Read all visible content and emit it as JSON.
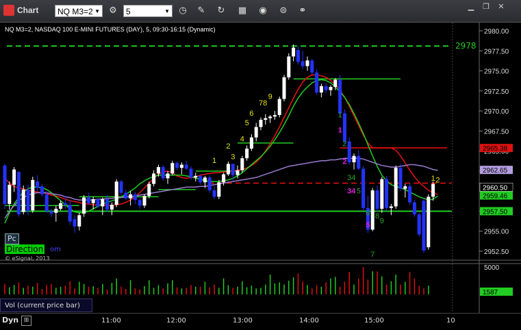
{
  "window": {
    "title": "Chart",
    "symbol": "NQ M3=2",
    "interval": "5",
    "buttons": [
      "interval-icon",
      "pencil-icon",
      "refresh-icon",
      "studies-icon",
      "play-icon",
      "properties-icon",
      "link-icon"
    ],
    "window_controls": [
      "minimize",
      "restore",
      "close"
    ]
  },
  "chart": {
    "series_title": "NQ M3=2, NASDAQ 100 E-MINI FUTURES (DAY), 5, 09:30-16:15 (Dynamic)",
    "pc_label": "Pc",
    "direction_label": "Direction",
    "copyright": "© eSignal, 2013",
    "volume_label": "Vol (current price bar)",
    "dyn_label": "Dyn",
    "top_line_label": "2978",
    "colors": {
      "up": "#ffffff",
      "down": "#2233ff",
      "green": "#22cc22",
      "red": "#ee1111",
      "purple": "#9b7bd0",
      "count_yellow": "#e5e51a",
      "count_green": "#29a829",
      "count_magenta": "#e020e0"
    }
  },
  "chart_data": {
    "type": "candlestick",
    "title": "NQ M3=2, NASDAQ 100 E-MINI FUTURES (DAY), 5, 09:30-16:15 (Dynamic)",
    "y_axis": {
      "ticks": [
        "2980.00",
        "2977.50",
        "2975.00",
        "2972.50",
        "2970.00",
        "2967.50",
        "2965.00",
        "2962.50",
        "2960.00",
        "2957.50",
        "2955.00",
        "2952.50"
      ],
      "range": [
        2951,
        2981.5
      ]
    },
    "x_axis": {
      "ticks": [
        "11:00",
        "12:00",
        "13:00",
        "14:00",
        "15:00",
        "10"
      ]
    },
    "price_labels": [
      {
        "text": "2965.38",
        "value": 2965.38,
        "bg": "#dd1111",
        "fg": "#000000"
      },
      {
        "text": "2962.65",
        "value": 2962.65,
        "bg": "#b49ee0",
        "fg": "#000000"
      },
      {
        "text": "2960.50",
        "value": 2960.5,
        "bg": "#000000",
        "fg": "#ffffff"
      },
      {
        "text": "2959.46",
        "value": 2959.46,
        "bg": "#22cc22",
        "fg": "#000000"
      },
      {
        "text": "2957.50",
        "value": 2957.5,
        "bg": "#22cc22",
        "fg": "#000000"
      }
    ],
    "volume_axis": {
      "ticks": [
        "5000",
        "1587"
      ]
    },
    "levels": [
      {
        "name": "top-dashed",
        "value": 2978.1,
        "color": "#22cc22",
        "style": "dashed"
      },
      {
        "name": "support",
        "value": 2957.5,
        "color": "#22cc22",
        "style": "solid"
      },
      {
        "name": "red-dashed",
        "value": 2961.0,
        "color": "#ee1111",
        "style": "dashed"
      }
    ],
    "candles": [
      [
        2963.2,
        2963.4,
        2957.8,
        2958.4
      ],
      [
        2958.4,
        2961.2,
        2957.7,
        2960.8
      ],
      [
        2960.8,
        2963.0,
        2959.9,
        2962.7
      ],
      [
        2962.4,
        2962.5,
        2956.8,
        2957.1
      ],
      [
        2957.4,
        2960.7,
        2957.1,
        2960.2
      ],
      [
        2960.2,
        2960.8,
        2957.0,
        2957.5
      ],
      [
        2957.6,
        2961.8,
        2957.3,
        2961.4
      ],
      [
        2961.2,
        2962.0,
        2960.0,
        2960.4
      ],
      [
        2960.6,
        2960.9,
        2959.3,
        2959.6
      ],
      [
        2959.6,
        2960.0,
        2957.3,
        2957.5
      ],
      [
        2957.5,
        2957.8,
        2956.8,
        2957.2
      ],
      [
        2957.3,
        2958.2,
        2956.2,
        2957.8
      ],
      [
        2957.8,
        2958.8,
        2957.6,
        2958.5
      ],
      [
        2958.5,
        2959.4,
        2957.8,
        2958.3
      ],
      [
        2958.3,
        2958.9,
        2955.8,
        2956.2
      ],
      [
        2956.5,
        2957.0,
        2954.8,
        2955.6
      ],
      [
        2955.6,
        2957.3,
        2955.1,
        2957.0
      ],
      [
        2957.2,
        2959.5,
        2956.8,
        2959.2
      ],
      [
        2959.2,
        2959.8,
        2958.3,
        2958.5
      ],
      [
        2958.5,
        2959.3,
        2957.7,
        2959.0
      ],
      [
        2959.0,
        2959.1,
        2957.9,
        2958.1
      ],
      [
        2958.1,
        2959.2,
        2957.0,
        2959.0
      ],
      [
        2959.0,
        2959.5,
        2957.4,
        2957.7
      ],
      [
        2957.7,
        2958.6,
        2957.0,
        2958.3
      ],
      [
        2958.3,
        2961.5,
        2958.0,
        2961.2
      ],
      [
        2961.2,
        2961.4,
        2959.5,
        2959.8
      ],
      [
        2959.8,
        2960.2,
        2958.9,
        2959.1
      ],
      [
        2959.1,
        2960.0,
        2958.2,
        2959.6
      ],
      [
        2959.6,
        2959.9,
        2958.4,
        2958.9
      ],
      [
        2958.9,
        2959.1,
        2957.8,
        2958.2
      ],
      [
        2958.2,
        2959.6,
        2957.9,
        2959.4
      ],
      [
        2959.4,
        2961.2,
        2959.1,
        2960.9
      ],
      [
        2960.9,
        2962.6,
        2960.6,
        2962.2
      ],
      [
        2962.2,
        2963.3,
        2961.8,
        2963.0
      ],
      [
        2963.0,
        2963.3,
        2961.3,
        2961.6
      ],
      [
        2961.6,
        2962.5,
        2960.9,
        2962.2
      ],
      [
        2962.2,
        2963.8,
        2962.0,
        2963.5
      ],
      [
        2963.5,
        2963.7,
        2962.6,
        2962.9
      ],
      [
        2962.9,
        2963.6,
        2962.1,
        2963.3
      ],
      [
        2963.3,
        2963.8,
        2962.6,
        2962.8
      ],
      [
        2962.8,
        2963.1,
        2961.4,
        2961.7
      ],
      [
        2961.7,
        2962.3,
        2961.2,
        2961.9
      ],
      [
        2961.9,
        2962.1,
        2960.8,
        2961.1
      ],
      [
        2961.1,
        2961.9,
        2960.4,
        2961.7
      ],
      [
        2961.7,
        2962.0,
        2959.8,
        2960.1
      ],
      [
        2960.1,
        2960.6,
        2959.0,
        2959.3
      ],
      [
        2959.3,
        2961.4,
        2959.0,
        2961.1
      ],
      [
        2961.1,
        2962.3,
        2960.7,
        2962.1
      ],
      [
        2962.1,
        2963.7,
        2961.9,
        2963.4
      ],
      [
        2963.4,
        2962.4,
        2961.2,
        2962.0
      ],
      [
        2962.0,
        2963.2,
        2961.6,
        2962.6
      ],
      [
        2962.6,
        2964.4,
        2962.3,
        2964.1
      ],
      [
        2964.1,
        2965.7,
        2963.8,
        2965.3
      ],
      [
        2965.3,
        2967.1,
        2965.0,
        2966.7
      ],
      [
        2966.7,
        2968.5,
        2966.2,
        2968.0
      ],
      [
        2968.0,
        2969.2,
        2967.6,
        2968.9
      ],
      [
        2968.9,
        2969.6,
        2968.3,
        2969.1
      ],
      [
        2969.1,
        2969.5,
        2968.5,
        2969.3
      ],
      [
        2969.3,
        2970.0,
        2968.9,
        2969.5
      ],
      [
        2969.5,
        2971.8,
        2969.2,
        2971.5
      ],
      [
        2971.5,
        2974.5,
        2971.2,
        2974.2
      ],
      [
        2974.2,
        2977.2,
        2973.9,
        2976.8
      ],
      [
        2976.8,
        2978.3,
        2976.2,
        2977.9
      ],
      [
        2977.6,
        2978.1,
        2975.8,
        2976.1
      ],
      [
        2976.2,
        2977.5,
        2975.2,
        2975.6
      ],
      [
        2975.6,
        2976.8,
        2975.0,
        2976.3
      ],
      [
        2976.3,
        2976.5,
        2974.5,
        2974.8
      ],
      [
        2974.8,
        2975.2,
        2972.0,
        2972.3
      ],
      [
        2972.3,
        2973.4,
        2971.7,
        2973.1
      ],
      [
        2973.1,
        2973.5,
        2972.2,
        2972.6
      ],
      [
        2972.6,
        2973.2,
        2971.9,
        2973.0
      ],
      [
        2973.0,
        2974.1,
        2972.6,
        2973.9
      ],
      [
        2973.9,
        2974.5,
        2969.3,
        2969.7
      ],
      [
        2969.7,
        2970.2,
        2965.9,
        2966.2
      ],
      [
        2966.2,
        2966.7,
        2963.3,
        2963.6
      ],
      [
        2963.6,
        2964.7,
        2962.7,
        2964.4
      ],
      [
        2964.4,
        2965.1,
        2962.6,
        2962.8
      ],
      [
        2962.8,
        2963.1,
        2957.6,
        2957.9
      ],
      [
        2957.9,
        2959.4,
        2954.8,
        2955.2
      ],
      [
        2955.2,
        2960.4,
        2955.0,
        2960.1
      ],
      [
        2960.1,
        2960.7,
        2957.4,
        2957.8
      ],
      [
        2957.8,
        2961.8,
        2957.3,
        2961.5
      ],
      [
        2961.5,
        2961.9,
        2957.5,
        2957.9
      ],
      [
        2957.9,
        2958.4,
        2957.0,
        2958.1
      ],
      [
        2958.1,
        2963.2,
        2957.8,
        2962.9
      ],
      [
        2962.9,
        2963.4,
        2960.0,
        2960.3
      ],
      [
        2960.3,
        2960.9,
        2959.2,
        2960.6
      ],
      [
        2960.6,
        2961.0,
        2958.3,
        2958.6
      ],
      [
        2958.6,
        2958.9,
        2956.8,
        2957.1
      ],
      [
        2957.1,
        2957.3,
        2954.3,
        2954.6
      ],
      [
        2958.8,
        2959.1,
        2952.3,
        2952.6
      ],
      [
        2953.0,
        2959.6,
        2952.7,
        2959.3
      ],
      [
        2959.3,
        2961.2,
        2958.8,
        2960.9
      ]
    ],
    "lines": {
      "red": [
        2961.6,
        2961.0,
        2960.6,
        2960.4,
        2960.3,
        2960.1,
        2960.0,
        2959.9,
        2959.8,
        2959.7,
        2959.5,
        2959.4,
        2959.2,
        2959.0,
        2958.8,
        2958.7,
        2958.6,
        2958.4,
        2958.4,
        2958.3,
        2958.3,
        2958.3,
        2958.2,
        2958.2,
        2958.3,
        2958.4,
        2958.6,
        2958.9,
        2959.3,
        2959.8,
        2960.4,
        2961.0,
        2961.6,
        2962.1,
        2962.4,
        2962.5,
        2962.3,
        2961.9,
        2961.7,
        2961.6,
        2961.7,
        2961.8,
        2962.0,
        2962.1,
        2962.2,
        2962.3,
        2962.3,
        2962.4,
        2962.4,
        2962.5,
        2962.6,
        2962.7,
        2962.9,
        2963.2,
        2963.6,
        2964.2,
        2965.0,
        2965.9,
        2966.9,
        2968.0,
        2969.2,
        2970.4,
        2971.6,
        2972.7,
        2973.6,
        2974.2,
        2974.5,
        2974.5,
        2974.4,
        2974.2,
        2973.8,
        2973.3,
        2972.6,
        2971.7,
        2970.6,
        2969.4,
        2968.2,
        2967.0,
        2966.0,
        2965.4,
        2965.4,
        2965.4,
        2965.4,
        2965.4,
        2965.1,
        2964.4,
        2963.5,
        2962.6,
        2961.8,
        2961.1,
        2960.6,
        2960.1,
        2959.8,
        2959.6
      ],
      "green": [
        2956.0,
        2957.3,
        2958.4,
        2959.2,
        2959.9,
        2960.3,
        2960.5,
        2960.5,
        2960.4,
        2960.2,
        2959.8,
        2959.3,
        2958.8,
        2958.3,
        2957.8,
        2957.4,
        2957.3,
        2957.3,
        2957.5,
        2957.8,
        2958.1,
        2958.4,
        2958.6,
        2958.8,
        2959.0,
        2959.3,
        2959.6,
        2960.0,
        2960.4,
        2960.9,
        2961.3,
        2961.6,
        2961.8,
        2962.0,
        2962.0,
        2962.0,
        2962.0,
        2962.0,
        2962.0,
        2961.9,
        2961.8,
        2961.6,
        2961.5,
        2961.3,
        2961.2,
        2961.2,
        2961.2,
        2961.3,
        2961.4,
        2961.6,
        2961.9,
        2962.3,
        2962.8,
        2963.3,
        2963.8,
        2964.3,
        2964.9,
        2965.6,
        2966.4,
        2967.3,
        2968.3,
        2969.4,
        2970.6,
        2971.6,
        2972.4,
        2973.0,
        2973.5,
        2973.8,
        2973.9,
        2973.8,
        2973.5,
        2973.0,
        2972.4,
        2971.7,
        2970.8,
        2969.7,
        2968.5,
        2967.2,
        2965.8,
        2964.4,
        2963.1,
        2962.0,
        2961.3,
        2960.8,
        2960.6,
        2960.4,
        2960.2,
        2959.9,
        2959.6,
        2959.3,
        2959.1,
        2958.9,
        2959.0,
        2959.4
      ],
      "purple": [
        2956.6,
        2957.5,
        2958.2,
        2958.8,
        2959.2,
        2959.5,
        2959.7,
        2959.8,
        2959.8,
        2959.8,
        2959.7,
        2959.6,
        2959.5,
        2959.3,
        2959.2,
        2959.0,
        2958.9,
        2958.9,
        2958.9,
        2958.9,
        2959.0,
        2959.0,
        2959.1,
        2959.1,
        2959.2,
        2959.2,
        2959.3,
        2959.3,
        2959.4,
        2959.5,
        2959.6,
        2959.7,
        2959.8,
        2959.9,
        2960.0,
        2960.1,
        2960.2,
        2960.3,
        2960.4,
        2960.5,
        2960.5,
        2960.5,
        2960.6,
        2960.6,
        2960.7,
        2960.8,
        2960.9,
        2961.0,
        2961.1,
        2961.2,
        2961.3,
        2961.4,
        2961.5,
        2961.6,
        2961.7,
        2961.9,
        2962.1,
        2962.3,
        2962.5,
        2962.7,
        2962.9,
        2963.1,
        2963.2,
        2963.3,
        2963.4,
        2963.5,
        2963.6,
        2963.7,
        2963.8,
        2963.8,
        2963.9,
        2963.9,
        2964.0,
        2964.1,
        2964.1,
        2964.1,
        2964.1,
        2964.0,
        2963.8,
        2963.6,
        2963.4,
        2963.2,
        2963.1,
        2963.0,
        2963.0,
        2963.1,
        2963.2,
        2963.3,
        2963.3,
        2963.2,
        2963.1,
        2962.9,
        2962.7,
        2962.6
      ]
    },
    "steps": {
      "green": [
        {
          "from": 0,
          "to": 16,
          "value": 2958.2
        },
        {
          "from": 16,
          "to": 33,
          "value": 2959.3
        },
        {
          "from": 33,
          "to": 41,
          "value": 2960.2
        },
        {
          "from": 41,
          "to": 50,
          "value": 2962.5
        },
        {
          "from": 50,
          "to": 62,
          "value": 2966.0
        },
        {
          "from": 62,
          "to": 85,
          "value": 2974.0
        }
      ],
      "red": [
        {
          "from": 72,
          "to": 95,
          "value": 2965.4
        }
      ]
    },
    "counts": [
      {
        "text": "1",
        "bar": 45,
        "value": 2963.5,
        "color": "yellow"
      },
      {
        "text": "2",
        "bar": 48,
        "value": 2965.3,
        "color": "yellow"
      },
      {
        "text": "3",
        "bar": 49,
        "value": 2964.0,
        "color": "yellow"
      },
      {
        "text": "4",
        "bar": 51,
        "value": 2966.2,
        "color": "yellow"
      },
      {
        "text": "5",
        "bar": 52,
        "value": 2968.2,
        "color": "yellow"
      },
      {
        "text": "6",
        "bar": 53,
        "value": 2969.4,
        "color": "yellow"
      },
      {
        "text": "78",
        "bar": 55,
        "value": 2970.7,
        "color": "yellow"
      },
      {
        "text": "9",
        "bar": 57,
        "value": 2971.5,
        "color": "yellow"
      },
      {
        "text": "1",
        "bar": 72,
        "value": 2969.2,
        "color": "green"
      },
      {
        "text": "1",
        "bar": 72,
        "value": 2967.3,
        "color": "magenta"
      },
      {
        "text": "2",
        "bar": 73,
        "value": 2965.6,
        "color": "green"
      },
      {
        "text": "2",
        "bar": 73,
        "value": 2963.4,
        "color": "magenta"
      },
      {
        "text": "34",
        "bar": 74,
        "value": 2961.4,
        "color": "green"
      },
      {
        "text": "34",
        "bar": 74,
        "value": 2959.7,
        "color": "magenta"
      },
      {
        "text": "5",
        "bar": 76,
        "value": 2959.7,
        "color": "green"
      },
      {
        "text": "6",
        "bar": 78,
        "value": 2957.0,
        "color": "green"
      },
      {
        "text": "8",
        "bar": 80,
        "value": 2956.6,
        "color": "green"
      },
      {
        "text": "9",
        "bar": 81,
        "value": 2956.0,
        "color": "green"
      },
      {
        "text": "5",
        "bar": 78,
        "value": 2955.5,
        "color": "magenta"
      },
      {
        "text": "7",
        "bar": 79,
        "value": 2951.8,
        "color": "green"
      },
      {
        "text": "1",
        "bar": 92,
        "value": 2961.3,
        "color": "yellow"
      },
      {
        "text": "2",
        "bar": 93,
        "value": 2961.1,
        "color": "yellow"
      }
    ],
    "volume": [
      1900,
      1300,
      1700,
      2200,
      1200,
      1600,
      1400,
      2100,
      1000,
      1700,
      1900,
      1200,
      1400,
      1600,
      2400,
      1100,
      2300,
      1900,
      1400,
      1500,
      1200,
      1900,
      900,
      2100,
      2900,
      1400,
      1000,
      2600,
      1100,
      900,
      1500,
      2600,
      1200,
      1700,
      1100,
      2000,
      2600,
      1300,
      1100,
      1200,
      1700,
      1400,
      1400,
      2300,
      1300,
      1800,
      1200,
      2900,
      1700,
      1200,
      1400,
      2400,
      1300,
      1600,
      1100,
      1200,
      1800,
      3600,
      2000,
      2200,
      1800,
      2500,
      3100,
      3800,
      2400,
      1700,
      1100,
      1700,
      1400,
      2200,
      2900,
      3200,
      1400,
      2300,
      4100,
      1800,
      2900,
      5000,
      2700,
      4200,
      4200,
      3300,
      1800,
      2400,
      3600,
      1800,
      2300,
      4100,
      2900,
      1600,
      1100,
      1587
    ]
  }
}
